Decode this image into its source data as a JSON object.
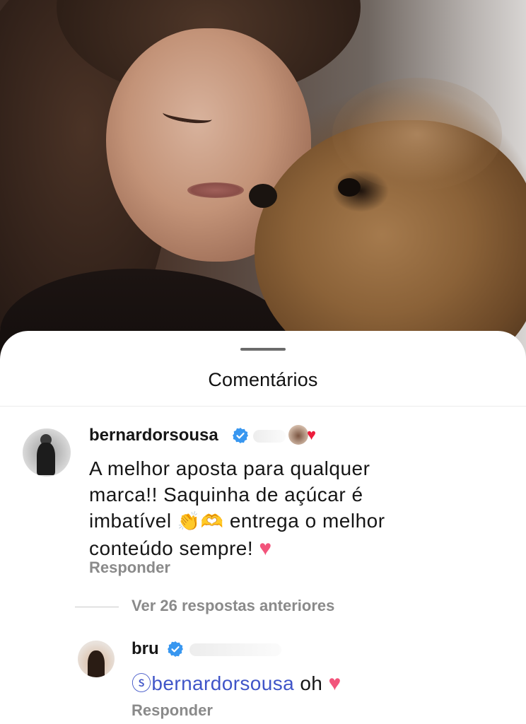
{
  "sheet": {
    "title": "Comentários"
  },
  "comments": [
    {
      "username": "bernardorsousa",
      "verified": true,
      "text_lines": [
        "A melhor aposta para qualquer",
        "marca!! Saquinha de açúcar é",
        "imbatível",
        "entrega o melhor",
        "conteúdo sempre!"
      ],
      "emojis": {
        "clap": "👏",
        "hand_heart": "🫶",
        "heart": "♥"
      },
      "liked_by_author": true,
      "reply_label": "Responder"
    }
  ],
  "view_replies": "Ver 26 respostas anteriores",
  "reply": {
    "username": "bru",
    "verified": true,
    "mention_icon": "ⓢ",
    "mention": "bernardorsousa",
    "text": "oh",
    "heart": "♥",
    "reply_label": "Responder"
  },
  "colors": {
    "verified_blue": "#3897f0",
    "heart_red": "#ed1c3c",
    "heart_pink": "#f2547b",
    "mention_blue": "#4055c8"
  }
}
